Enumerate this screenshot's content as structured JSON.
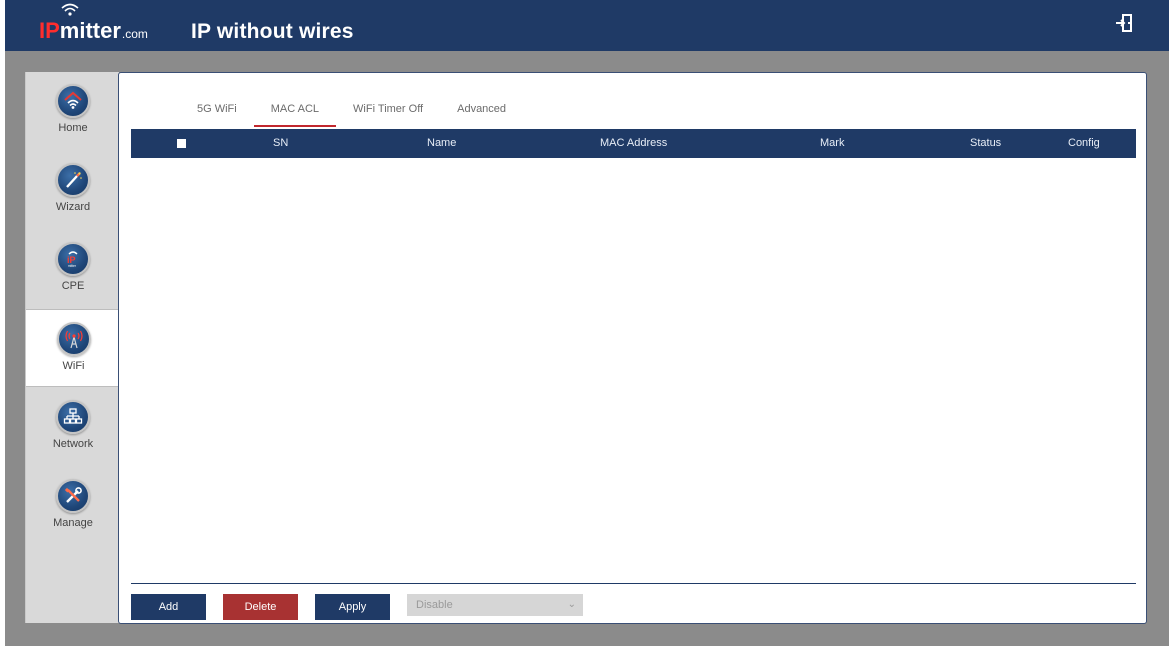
{
  "header": {
    "logo_prefix": "IP",
    "logo_main": "mitter",
    "logo_suffix": ".com",
    "app_title": "IP without wires",
    "logout_icon": "logout-icon"
  },
  "sidebar": {
    "items": [
      {
        "label": "Home",
        "icon": "home-wifi-icon"
      },
      {
        "label": "Wizard",
        "icon": "wand-icon"
      },
      {
        "label": "CPE",
        "icon": "ipmitter-cpe-icon"
      },
      {
        "label": "WiFi",
        "icon": "antenna-icon",
        "active": true
      },
      {
        "label": "Network",
        "icon": "network-icon"
      },
      {
        "label": "Manage",
        "icon": "tools-icon"
      }
    ]
  },
  "tabs": [
    {
      "label": "5G WiFi"
    },
    {
      "label": "MAC ACL",
      "active": true
    },
    {
      "label": "WiFi Timer Off"
    },
    {
      "label": "Advanced"
    }
  ],
  "table": {
    "columns": [
      "SN",
      "Name",
      "MAC Address",
      "Mark",
      "Status",
      "Config"
    ],
    "rows": []
  },
  "actions": {
    "add_label": "Add",
    "delete_label": "Delete",
    "apply_label": "Apply",
    "mode_select_value": "Disable"
  },
  "colors": {
    "brand_navy": "#1f3a66",
    "delete_red": "#a83232",
    "tab_active_underline": "#c1272d"
  }
}
